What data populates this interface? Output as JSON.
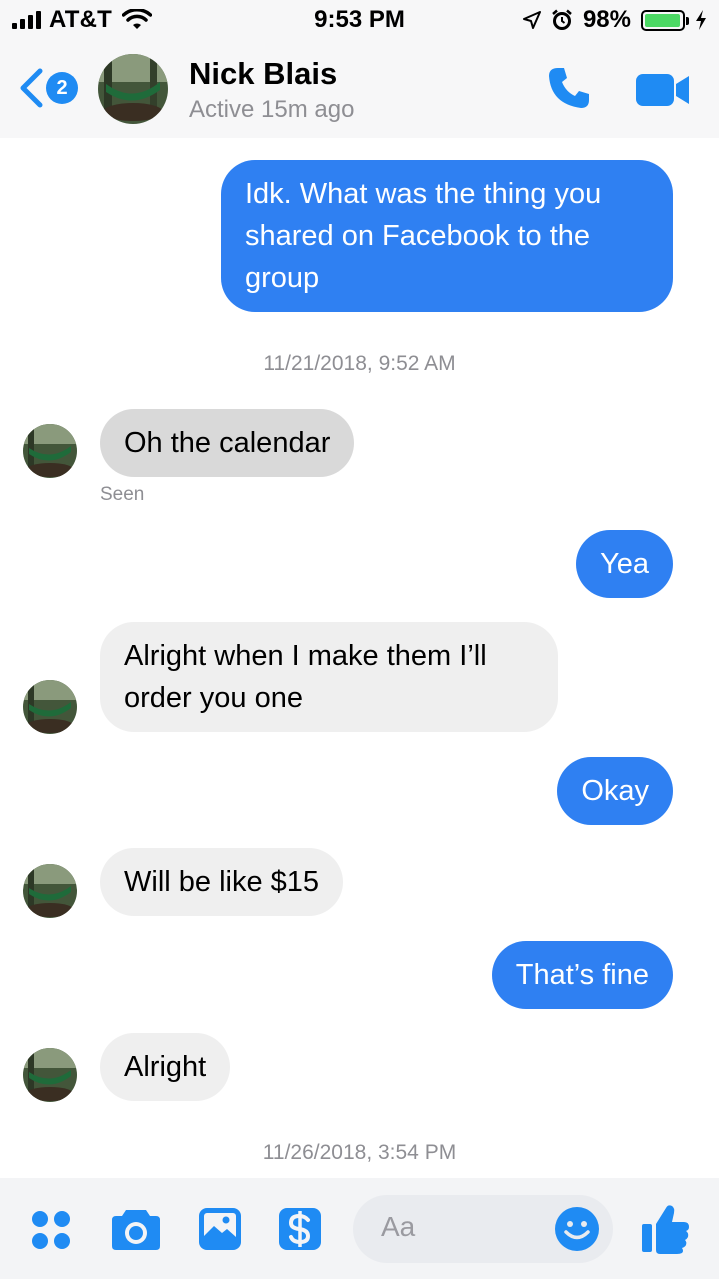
{
  "status_bar": {
    "carrier": "AT&T",
    "time": "9:53 PM",
    "battery_percent": "98%",
    "battery_level": 0.98,
    "battery_color": "#4cd964",
    "icons": [
      "cellular-signal-icon",
      "wifi-icon",
      "location-arrow-icon",
      "alarm-icon",
      "battery-icon",
      "charging-bolt-icon"
    ]
  },
  "header": {
    "back_badge": "2",
    "contact_name": "Nick Blais",
    "contact_status": "Active 15m ago",
    "icons": [
      "back-chevron-icon",
      "phone-icon",
      "video-camera-icon"
    ]
  },
  "conversation": {
    "messages": [
      {
        "direction": "out",
        "text": "Idk. What was the thing you shared on Facebook to the group"
      },
      {
        "type": "timestamp",
        "text": "11/21/2018, 9:52 AM"
      },
      {
        "direction": "in",
        "text": "Oh the calendar",
        "receipt": "Seen"
      },
      {
        "direction": "out",
        "text": "Yea"
      },
      {
        "direction": "in",
        "text": "Alright when I make them I’ll order you one"
      },
      {
        "direction": "out",
        "text": "Okay"
      },
      {
        "direction": "in",
        "text": "Will be like $15"
      },
      {
        "direction": "out",
        "text": "That’s fine"
      },
      {
        "direction": "in",
        "text": "Alright"
      },
      {
        "type": "timestamp",
        "text": "11/26/2018, 3:54 PM"
      }
    ]
  },
  "composer": {
    "placeholder": "Aa",
    "icons": [
      "more-options-icon",
      "camera-icon",
      "photo-gallery-icon",
      "payment-icon",
      "emoji-icon",
      "thumbs-up-icon"
    ]
  },
  "colors": {
    "accent": "#1f8bf3",
    "outgoing_bubble": "#2f80f2",
    "incoming_bubble": "#efefef",
    "secondary_text": "#8e8e93"
  }
}
